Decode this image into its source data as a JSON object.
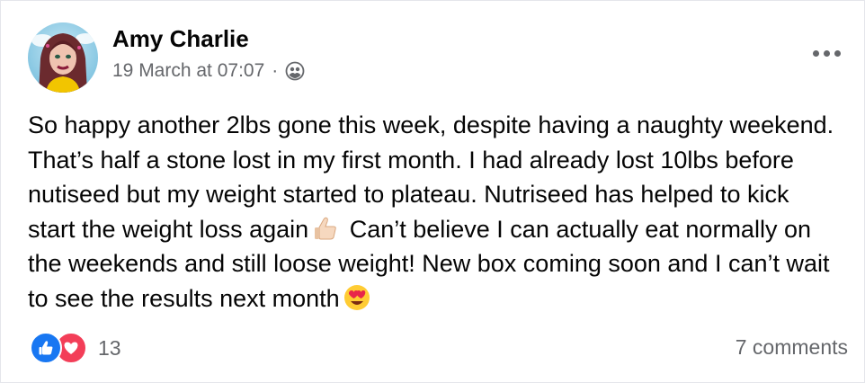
{
  "post": {
    "author": "Amy Charlie",
    "date": "19 March at 07:07",
    "separator": "·",
    "privacy_icon": "friends-icon",
    "more_icon": "more-options-icon",
    "text_part1": "So happy another 2lbs gone this week, despite having a naughty weekend. That’s half a stone lost in my first month. I had already lost 10lbs before nutiseed but my weight started to plateau. Nutriseed has helped to kick start the weight loss again",
    "emoji1": "thumbs-up-emoji",
    "text_part2": "Can’t believe I can actually eat normally on the weekends and still loose weight! New box coming soon and I can’t wait to see the results next month",
    "emoji2": "heart-eyes-emoji"
  },
  "footer": {
    "reaction_icons": [
      "like-icon",
      "love-icon"
    ],
    "reaction_count": "13",
    "comments": "7 comments"
  },
  "colors": {
    "like_blue": "#1877f2",
    "love_red": "#f33e58",
    "secondary_text": "#65676b",
    "primary_text": "#050505"
  }
}
